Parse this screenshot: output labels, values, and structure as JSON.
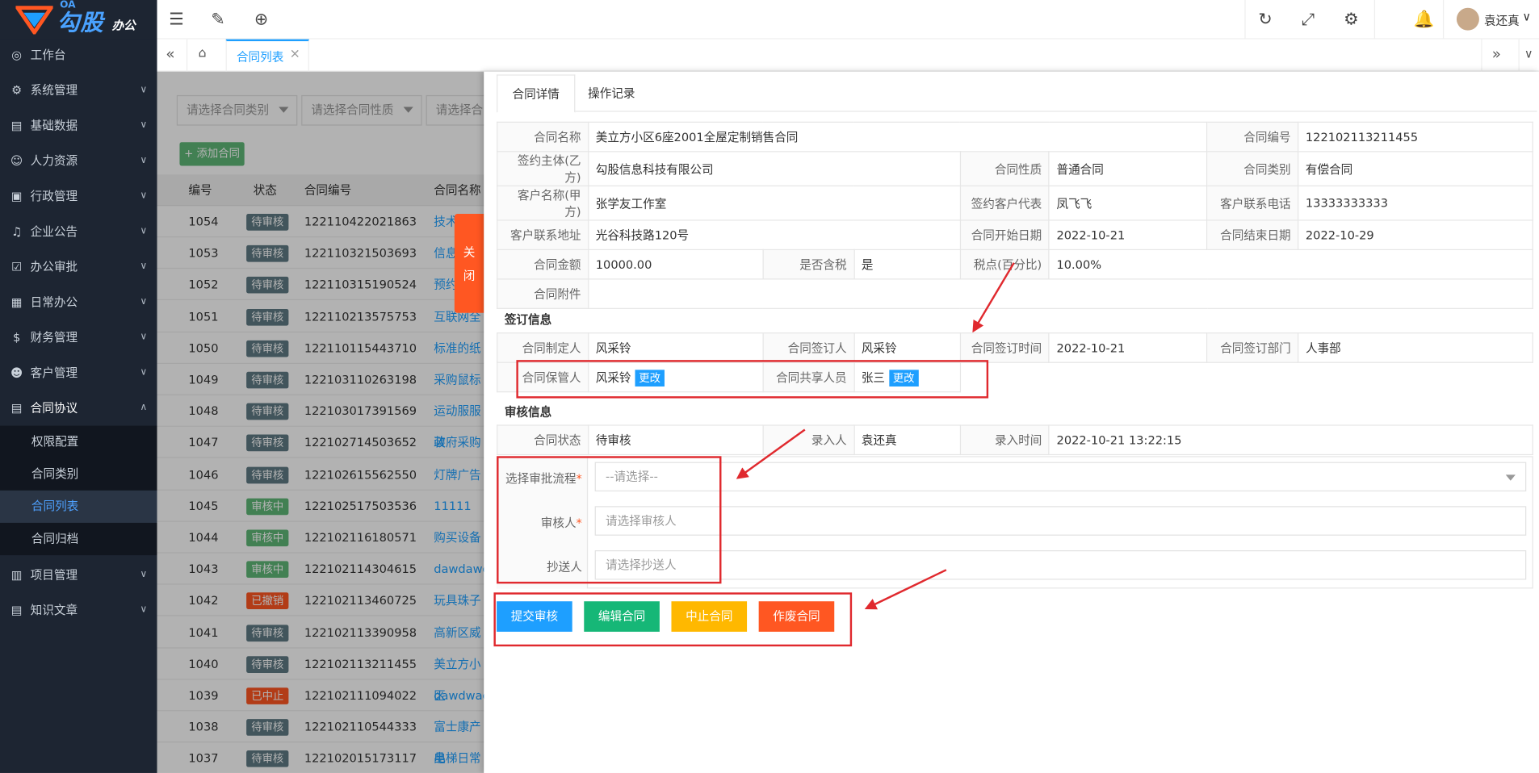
{
  "app": {
    "logo_main": "勾股",
    "logo_sub": "办公",
    "logo_oa": "OA"
  },
  "sidebar": {
    "items": [
      {
        "label": "工作台",
        "icon": "dashboard-icon"
      },
      {
        "label": "系统管理",
        "icon": "gear-icon"
      },
      {
        "label": "基础数据",
        "icon": "database-icon"
      },
      {
        "label": "人力资源",
        "icon": "user-icon"
      },
      {
        "label": "行政管理",
        "icon": "admin-icon"
      },
      {
        "label": "企业公告",
        "icon": "bell-icon"
      },
      {
        "label": "办公审批",
        "icon": "approval-icon"
      },
      {
        "label": "日常办公",
        "icon": "calendar-icon"
      },
      {
        "label": "财务管理",
        "icon": "finance-icon"
      },
      {
        "label": "客户管理",
        "icon": "customer-icon"
      },
      {
        "label": "合同协议",
        "icon": "contract-icon"
      },
      {
        "label": "项目管理",
        "icon": "project-icon"
      },
      {
        "label": "知识文章",
        "icon": "article-icon"
      }
    ],
    "subitems": [
      "权限配置",
      "合同类别",
      "合同列表",
      "合同归档"
    ],
    "active_sub": "合同列表"
  },
  "topbar": {
    "user_name": "袁还真"
  },
  "tabs": {
    "active_label": "合同列表",
    "close": "×"
  },
  "list": {
    "filter1_placeholder": "请选择合同类别",
    "filter2_placeholder": "请选择合同性质",
    "filter3_placeholder": "请选择合",
    "add_button": "+ 添加合同",
    "headers": [
      "编号",
      "状态",
      "合同编号",
      "合同名称"
    ],
    "rows": [
      {
        "id": "1054",
        "status": "待审核",
        "code": "122110422021863",
        "name": "技术"
      },
      {
        "id": "1053",
        "status": "待审核",
        "code": "122110321503693",
        "name": "信息"
      },
      {
        "id": "1052",
        "status": "待审核",
        "code": "122110315190524",
        "name": "预约"
      },
      {
        "id": "1051",
        "status": "待审核",
        "code": "122110213575753",
        "name": "互联网全"
      },
      {
        "id": "1050",
        "status": "待审核",
        "code": "122110115443710",
        "name": "标准的纸"
      },
      {
        "id": "1049",
        "status": "待审核",
        "code": "122103110263198",
        "name": "采购鼠标"
      },
      {
        "id": "1048",
        "status": "待审核",
        "code": "122103017391569",
        "name": "运动服服装"
      },
      {
        "id": "1047",
        "status": "待审核",
        "code": "122102714503652",
        "name": "政府采购"
      },
      {
        "id": "1046",
        "status": "待审核",
        "code": "122102615562550",
        "name": "灯牌广告"
      },
      {
        "id": "1045",
        "status": "审核中",
        "code": "122102517503536",
        "name": "11111"
      },
      {
        "id": "1044",
        "status": "审核中",
        "code": "122102116180571",
        "name": "购买设备"
      },
      {
        "id": "1043",
        "status": "审核中",
        "code": "122102114304615",
        "name": "dawdawd"
      },
      {
        "id": "1042",
        "status": "已撤销",
        "code": "122102113460725",
        "name": "玩具珠子"
      },
      {
        "id": "1041",
        "status": "待审核",
        "code": "122102113390958",
        "name": "高新区威"
      },
      {
        "id": "1040",
        "status": "待审核",
        "code": "122102113211455",
        "name": "美立方小区"
      },
      {
        "id": "1039",
        "status": "已中止",
        "code": "122102111094022",
        "name": "dawdwada"
      },
      {
        "id": "1038",
        "status": "待审核",
        "code": "122102110544333",
        "name": "富士康产品"
      },
      {
        "id": "1037",
        "status": "待审核",
        "code": "122102015173117",
        "name": "电梯日常"
      }
    ]
  },
  "status_colors": {
    "待审核": "#5f7a84",
    "审核中": "#5fb878",
    "已撤销": "#ff5722",
    "已中止": "#ff5722"
  },
  "close_label": [
    "关",
    "闭"
  ],
  "panel": {
    "tab_detail": "合同详情",
    "tab_log": "操作记录",
    "labels": {
      "name": "合同名称",
      "code": "合同编号",
      "party_b": "签约主体(乙方)",
      "nature": "合同性质",
      "category": "合同类别",
      "customer": "客户名称(甲方)",
      "rep": "签约客户代表",
      "phone": "客户联系电话",
      "address": "客户联系地址",
      "start": "合同开始日期",
      "end": "合同结束日期",
      "amount": "合同金额",
      "tax_incl": "是否含税",
      "tax_rate": "税点(百分比)",
      "attach": "合同附件",
      "maker": "合同制定人",
      "signer": "合同签订人",
      "sign_time": "合同签订时间",
      "sign_dept": "合同签订部门",
      "keeper": "合同保管人",
      "sharer": "合同共享人员",
      "state": "合同状态",
      "entry": "录入人",
      "entry_time": "录入时间"
    },
    "values": {
      "name": "美立方小区6座2001全屋定制销售合同",
      "code": "122102113211455",
      "party_b": "勾股信息科技有限公司",
      "nature": "普通合同",
      "category": "有偿合同",
      "customer": "张学友工作室",
      "rep": "凤飞飞",
      "phone": "13333333333",
      "address": "光谷科技路120号",
      "start": "2022-10-21",
      "end": "2022-10-29",
      "amount": "10000.00",
      "tax_incl": "是",
      "tax_rate": "10.00%",
      "attach": "",
      "maker": "风采铃",
      "signer": "风采铃",
      "sign_time": "2022-10-21",
      "sign_dept": "人事部",
      "keeper": "风采铃",
      "sharer": "张三",
      "state": "待审核",
      "entry": "袁还真",
      "entry_time": "2022-10-21 13:22:15"
    },
    "change_label": "更改",
    "section_sign": "签订信息",
    "section_audit": "审核信息",
    "flow_label": "选择审批流程",
    "flow_placeholder": "--请选择--",
    "auditor_label": "审核人",
    "auditor_placeholder": "请选择审核人",
    "cc_label": "抄送人",
    "cc_placeholder": "请选择抄送人",
    "required_mark": "*",
    "buttons": {
      "submit": "提交审核",
      "edit": "编辑合同",
      "stop": "中止合同",
      "void": "作废合同"
    }
  },
  "colors": {
    "submit": "#1e9fff",
    "edit": "#16b777",
    "stop": "#ffb800",
    "void": "#ff5722",
    "annotation": "#e0292e"
  }
}
